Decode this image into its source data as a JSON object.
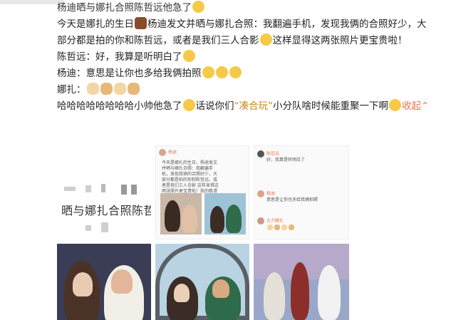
{
  "post": {
    "title": "杨迪晒与娜扎合照陈哲远他急了",
    "line1_a": "今天是娜扎的生日",
    "line1_b": "杨迪发文并晒与娜扎合照：我翻遍手机，发现我俩的合照好少，大",
    "line2_a": "部分都是拍的你和陈哲远，或者是我们三人合影",
    "line2_b": "这样显得这两张照片更宝贵啦！",
    "line3": "陈哲远：好，我算是听明白了",
    "line4": "杨迪：意思是让你也多给我俩拍照",
    "line5": "娜扎：",
    "line6_a": "哈哈哈哈哈哈哈哈小帅他急了",
    "line6_b": "话说你们",
    "line6_quote": "“凑合玩”",
    "line6_c": "小分队啥时候能重聚一下啊",
    "expand": "收起",
    "expand_icon": "caret-up-icon"
  },
  "images": {
    "c1_text": "晒与娜扎合照陈哲",
    "c2": {
      "name": "杨迪",
      "text": "今天是娜扎的生日，杨迪发文并晒与娜扎合照：我翻遍手机，发现我俩的合照好少，大部分都是拍的你和陈哲远，或者是我们三人合影 这样显得这两张照片更宝贵啦！我的敬请期待吧，且见收获"
    },
    "c3": {
      "r1_name": "陈哲远",
      "r1_text": "好，我算是听明白了",
      "r2_name": "杨迪",
      "r2_text": "意思是让你也多给我俩拍照",
      "r3_name": "古力娜扎",
      "r3_text": ""
    }
  },
  "colors": {
    "link": "#eb7350",
    "quote": "#c88a1a",
    "emoji": "#f7c948"
  }
}
